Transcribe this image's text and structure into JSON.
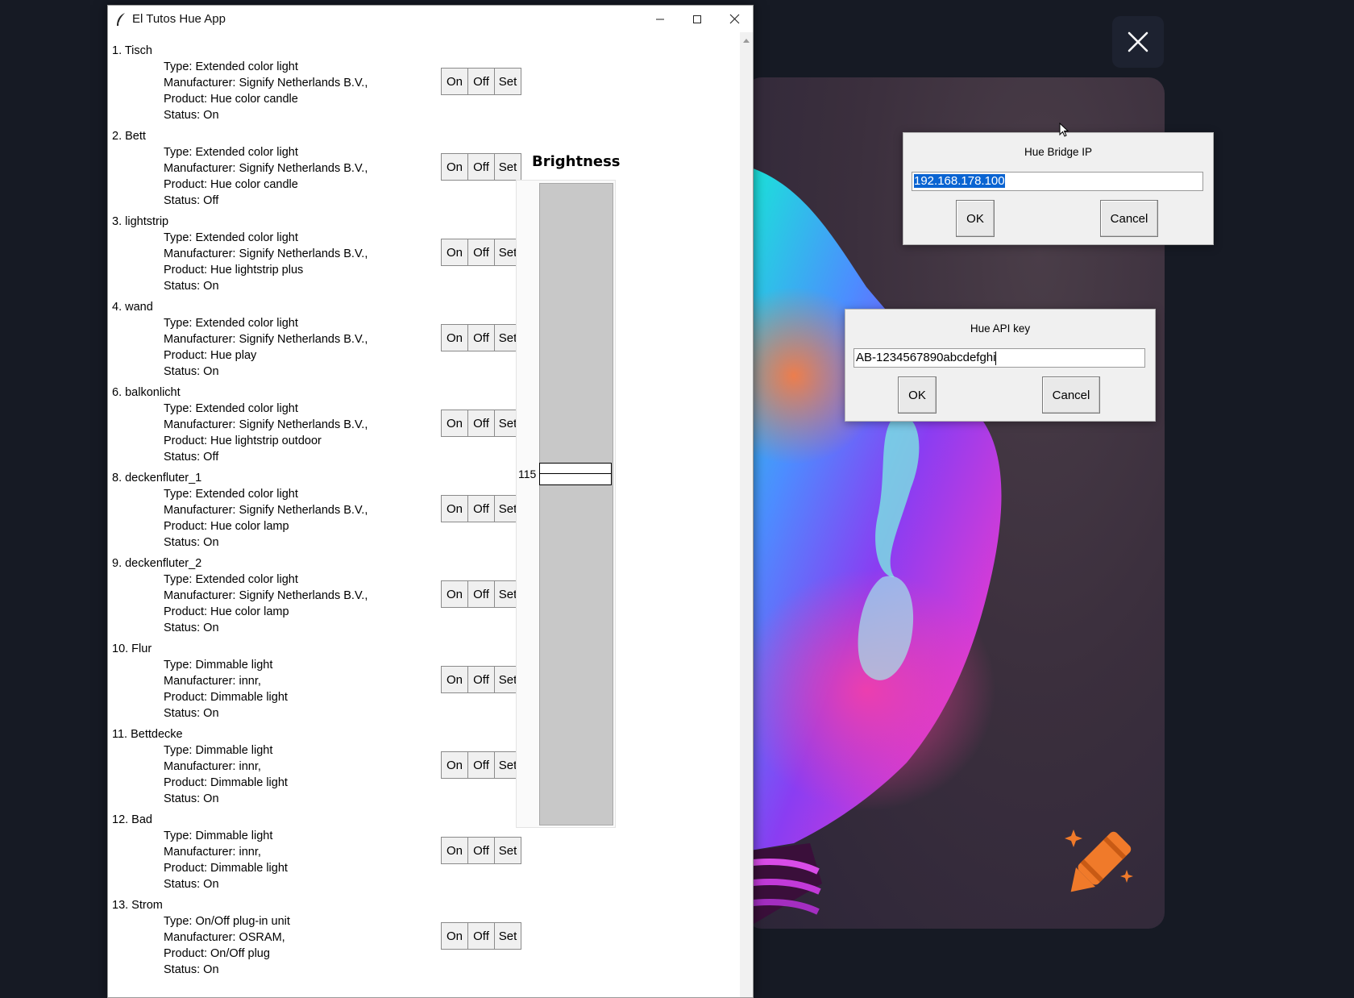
{
  "window": {
    "title": "El Tutos Hue App"
  },
  "lights": [
    {
      "name": "1. Tisch",
      "type": "Type: Extended color light",
      "manufacturer": "Manufacturer: Signify Netherlands B.V.,",
      "product": "Product: Hue color candle",
      "status": "Status: On"
    },
    {
      "name": "2. Bett",
      "type": "Type: Extended color light",
      "manufacturer": "Manufacturer: Signify Netherlands B.V.,",
      "product": "Product: Hue color candle",
      "status": "Status: Off"
    },
    {
      "name": "3. lightstrip",
      "type": "Type: Extended color light",
      "manufacturer": "Manufacturer: Signify Netherlands B.V.,",
      "product": "Product: Hue lightstrip plus",
      "status": "Status: On"
    },
    {
      "name": "4. wand",
      "type": "Type: Extended color light",
      "manufacturer": "Manufacturer: Signify Netherlands B.V.,",
      "product": "Product: Hue play",
      "status": "Status: On"
    },
    {
      "name": "6. balkonlicht",
      "type": "Type: Extended color light",
      "manufacturer": "Manufacturer: Signify Netherlands B.V.,",
      "product": "Product: Hue lightstrip outdoor",
      "status": "Status: Off"
    },
    {
      "name": "8. deckenfluter_1",
      "type": "Type: Extended color light",
      "manufacturer": "Manufacturer: Signify Netherlands B.V.,",
      "product": "Product: Hue color lamp",
      "status": "Status: On"
    },
    {
      "name": "9. deckenfluter_2",
      "type": "Type: Extended color light",
      "manufacturer": "Manufacturer: Signify Netherlands B.V.,",
      "product": "Product: Hue color lamp",
      "status": "Status: On"
    },
    {
      "name": "10. Flur",
      "type": "Type: Dimmable light",
      "manufacturer": "Manufacturer: innr,",
      "product": "Product: Dimmable light",
      "status": "Status: On"
    },
    {
      "name": "11. Bettdecke",
      "type": "Type: Dimmable light",
      "manufacturer": "Manufacturer: innr,",
      "product": "Product: Dimmable light",
      "status": "Status: On"
    },
    {
      "name": "12. Bad",
      "type": "Type: Dimmable light",
      "manufacturer": "Manufacturer: innr,",
      "product": "Product: Dimmable light",
      "status": "Status: On"
    },
    {
      "name": "13. Strom",
      "type": "Type: On/Off plug-in unit",
      "manufacturer": "Manufacturer: OSRAM,",
      "product": "Product: On/Off plug",
      "status": "Status: On"
    }
  ],
  "buttons": {
    "on": "On",
    "off": "Off",
    "set": "Set"
  },
  "brightness": {
    "label": "Brightness",
    "value": "115",
    "max": 254
  },
  "dialogs": {
    "bridge_ip": {
      "label": "Hue Bridge IP",
      "value": "192.168.178.100",
      "ok": "OK",
      "cancel": "Cancel"
    },
    "api_key": {
      "label": "Hue API key",
      "value": "AB-1234567890abcdefghi",
      "ok": "OK",
      "cancel": "Cancel"
    }
  },
  "colors": {
    "selection": "#0a64d2",
    "viewer_background": "#161a24",
    "crayon_logo": "#f07a2a"
  }
}
